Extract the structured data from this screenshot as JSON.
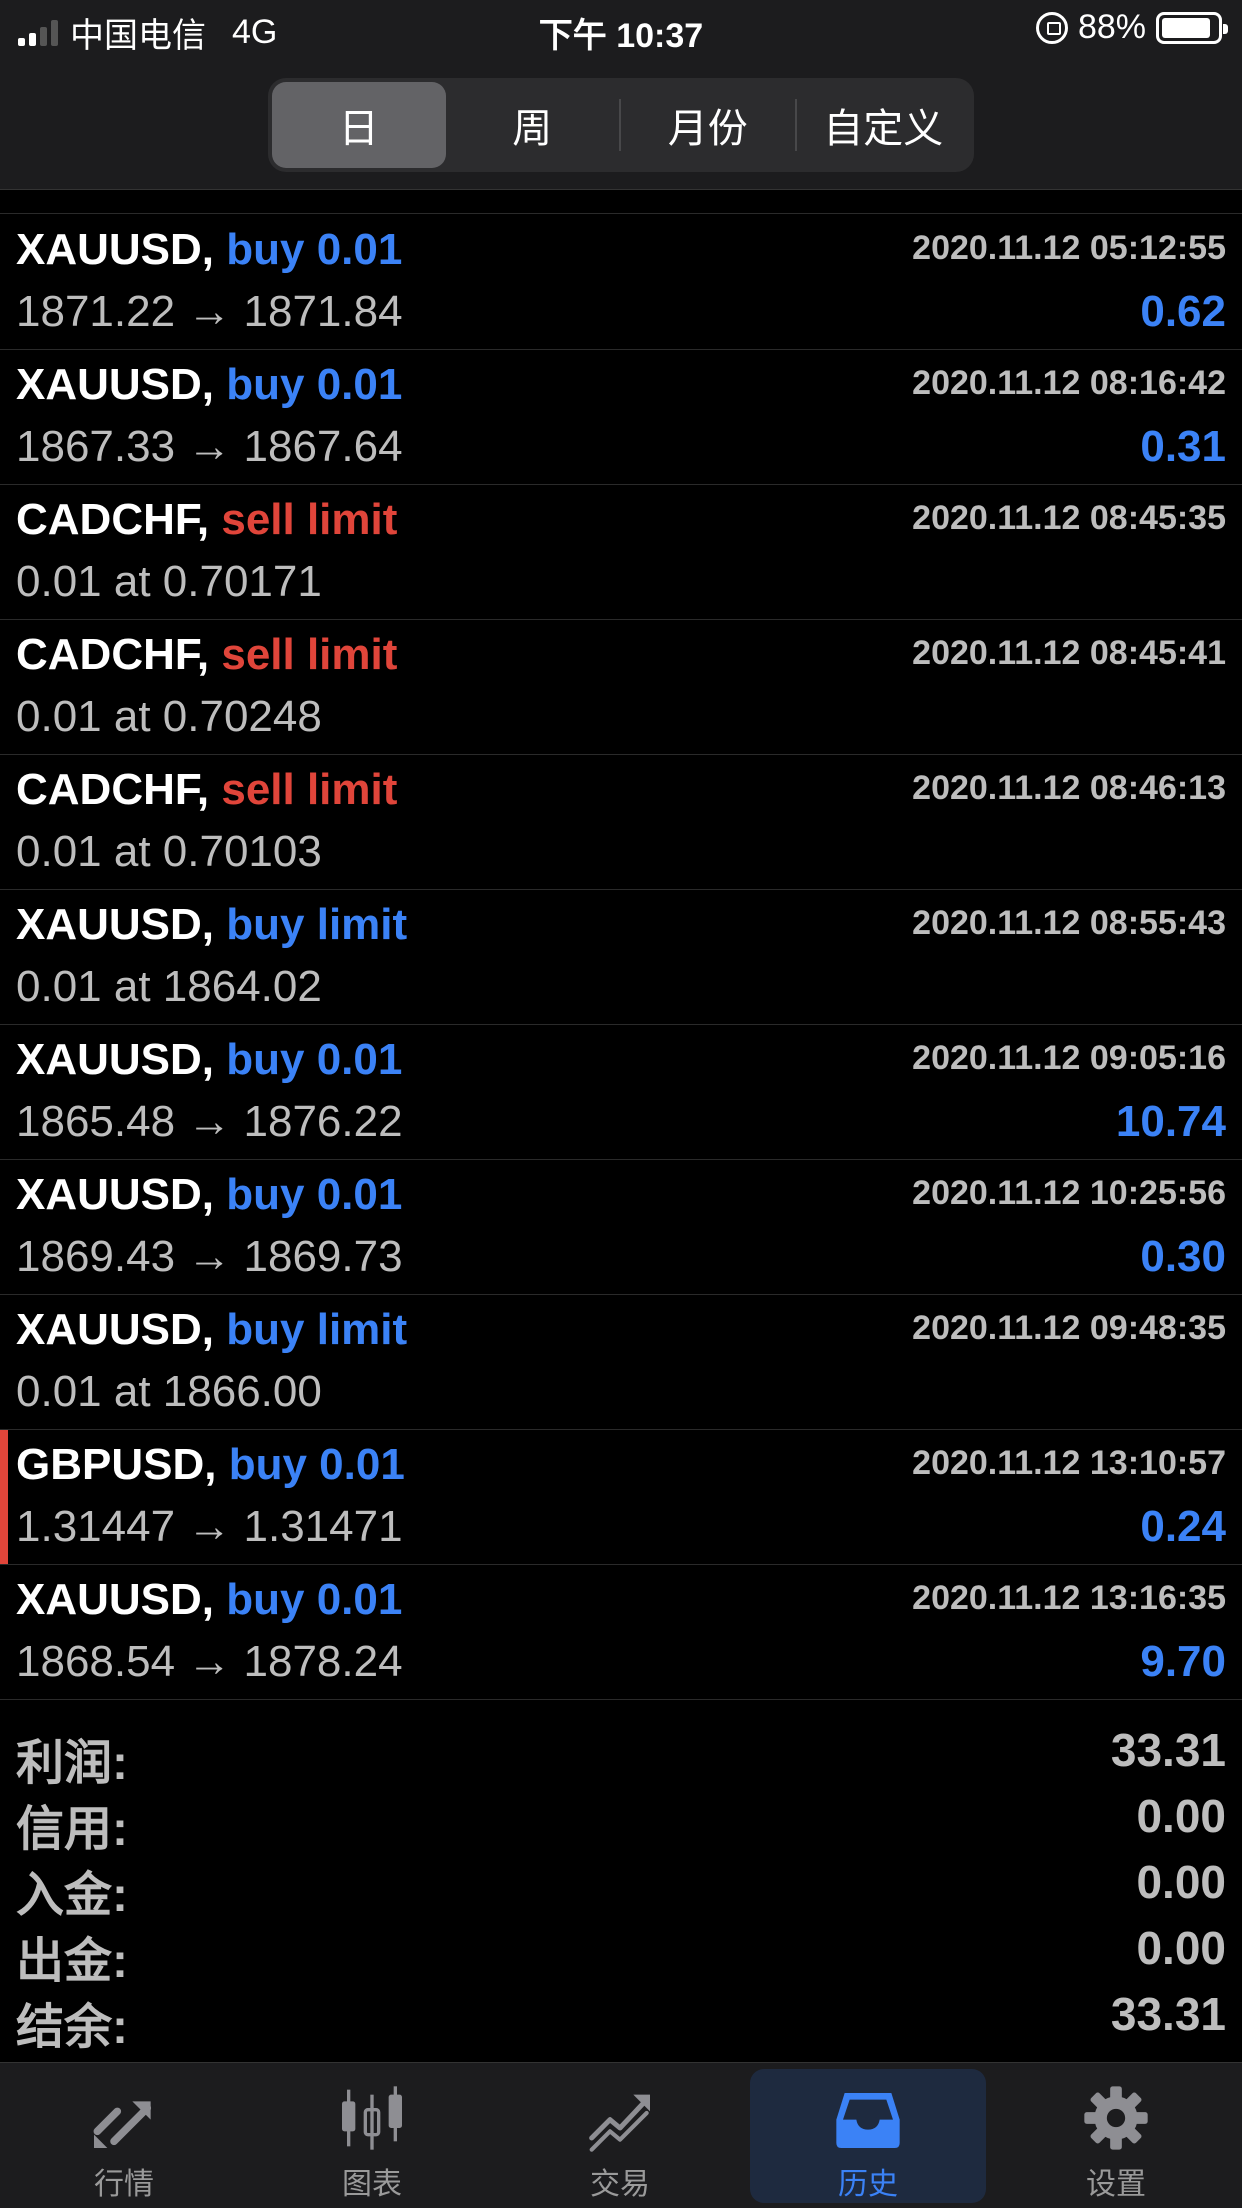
{
  "status_bar": {
    "carrier": "中国电信",
    "network": "4G",
    "time": "下午 10:37",
    "battery": "88%"
  },
  "segments": [
    {
      "label": "日",
      "active": true
    },
    {
      "label": "周",
      "active": false
    },
    {
      "label": "月份",
      "active": false
    },
    {
      "label": "自定义",
      "active": false
    }
  ],
  "rows": [
    {
      "symbol": "XAUUSD,",
      "action": "buy 0.01",
      "type": "buy",
      "time": "2020.11.12 05:12:55",
      "detail": "1871.22 → 1871.84",
      "profit": "0.62"
    },
    {
      "symbol": "XAUUSD,",
      "action": "buy 0.01",
      "type": "buy",
      "time": "2020.11.12 08:16:42",
      "detail": "1867.33 → 1867.64",
      "profit": "0.31"
    },
    {
      "symbol": "CADCHF,",
      "action": "sell limit",
      "type": "sell",
      "time": "2020.11.12 08:45:35",
      "detail": "0.01 at 0.70171",
      "profit": ""
    },
    {
      "symbol": "CADCHF,",
      "action": "sell limit",
      "type": "sell",
      "time": "2020.11.12 08:45:41",
      "detail": "0.01 at 0.70248",
      "profit": ""
    },
    {
      "symbol": "CADCHF,",
      "action": "sell limit",
      "type": "sell",
      "time": "2020.11.12 08:46:13",
      "detail": "0.01 at 0.70103",
      "profit": ""
    },
    {
      "symbol": "XAUUSD,",
      "action": "buy limit",
      "type": "buy",
      "time": "2020.11.12 08:55:43",
      "detail": "0.01 at 1864.02",
      "profit": ""
    },
    {
      "symbol": "XAUUSD,",
      "action": "buy 0.01",
      "type": "buy",
      "time": "2020.11.12 09:05:16",
      "detail": "1865.48 → 1876.22",
      "profit": "10.74"
    },
    {
      "symbol": "XAUUSD,",
      "action": "buy 0.01",
      "type": "buy",
      "time": "2020.11.12 10:25:56",
      "detail": "1869.43 → 1869.73",
      "profit": "0.30"
    },
    {
      "symbol": "XAUUSD,",
      "action": "buy limit",
      "type": "buy",
      "time": "2020.11.12 09:48:35",
      "detail": "0.01 at 1866.00",
      "profit": ""
    },
    {
      "symbol": "GBPUSD,",
      "action": "buy 0.01",
      "type": "buy",
      "time": "2020.11.12 13:10:57",
      "detail": "1.31447 → 1.31471",
      "profit": "0.24",
      "marked": true
    },
    {
      "symbol": "XAUUSD,",
      "action": "buy 0.01",
      "type": "buy",
      "time": "2020.11.12 13:16:35",
      "detail": "1868.54 → 1878.24",
      "profit": "9.70"
    }
  ],
  "summary": [
    {
      "label": "利润:",
      "value": "33.31"
    },
    {
      "label": "信用:",
      "value": "0.00"
    },
    {
      "label": "入金:",
      "value": "0.00"
    },
    {
      "label": "出金:",
      "value": "0.00"
    },
    {
      "label": "结余:",
      "value": "33.31"
    }
  ],
  "tabs": [
    {
      "label": "行情",
      "icon": "quotes-arrows-icon",
      "active": false
    },
    {
      "label": "图表",
      "icon": "candlestick-chart-icon",
      "active": false
    },
    {
      "label": "交易",
      "icon": "trade-chart-icon",
      "active": false
    },
    {
      "label": "历史",
      "icon": "inbox-tray-icon",
      "active": true
    },
    {
      "label": "设置",
      "icon": "gear-icon",
      "active": false
    }
  ],
  "colors": {
    "buy": "#3b82f6",
    "sell": "#e0453a",
    "active_tab": "#3b82f6"
  }
}
